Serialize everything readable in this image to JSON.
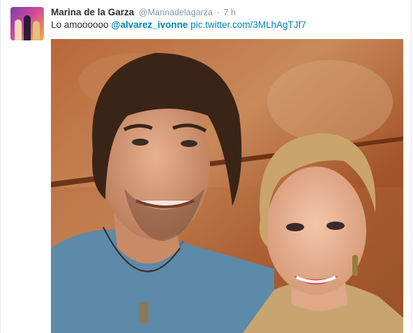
{
  "tweet": {
    "fullname": "Marina de la Garza",
    "handle": "@Marinadelagarza",
    "separator": "·",
    "time": "7 h",
    "text_prefix": "Lo amoooooo ",
    "mention_at": "@",
    "mention": "alvarez_ivonne",
    "link": "pic.twitter.com/3MLhAgTJf7"
  },
  "icons": {
    "avatar": "profile-photo",
    "media": "selfie-photo"
  },
  "colors": {
    "link": "#0084b4",
    "text": "#292f33",
    "muted": "#8899a6"
  }
}
